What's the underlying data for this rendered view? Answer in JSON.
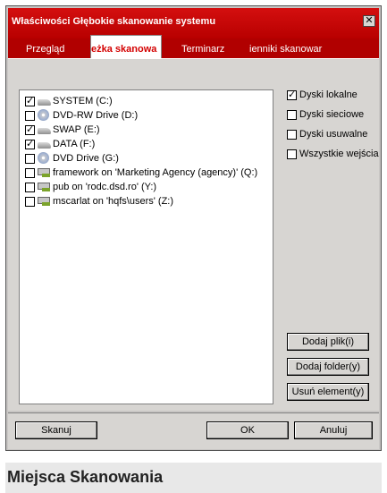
{
  "window": {
    "title": "Właściwości Głębokie skanowanie systemu"
  },
  "tabs": [
    {
      "label": "Przegląd",
      "active": false
    },
    {
      "label": "eżka skanowa",
      "active": true
    },
    {
      "label": "Terminarz",
      "active": false
    },
    {
      "label": "ienniki skanowar",
      "active": false
    }
  ],
  "drives": [
    {
      "label": "SYSTEM (C:)",
      "checked": true,
      "icon": "hdd-icon"
    },
    {
      "label": "DVD-RW Drive (D:)",
      "checked": false,
      "icon": "cd-drive-icon"
    },
    {
      "label": "SWAP (E:)",
      "checked": true,
      "icon": "hdd-icon"
    },
    {
      "label": "DATA (F:)",
      "checked": true,
      "icon": "hdd-icon"
    },
    {
      "label": "DVD Drive (G:)",
      "checked": false,
      "icon": "cd-drive-icon"
    },
    {
      "label": "framework on 'Marketing Agency (agency)' (Q:)",
      "checked": false,
      "icon": "network-drive-icon"
    },
    {
      "label": "pub on 'rodc.dsd.ro' (Y:)",
      "checked": false,
      "icon": "network-drive-icon"
    },
    {
      "label": "mscarlat on 'hqfs\\users' (Z:)",
      "checked": false,
      "icon": "network-drive-icon"
    }
  ],
  "options": [
    {
      "label": "Dyski lokalne",
      "checked": true
    },
    {
      "label": "Dyski sieciowe",
      "checked": false
    },
    {
      "label": "Dyski usuwalne",
      "checked": false
    },
    {
      "label": "Wszystkie wejścia",
      "checked": false
    }
  ],
  "buttons": {
    "add_file": "Dodaj plik(i)",
    "add_folder": "Dodaj folder(y)",
    "remove": "Usuń element(y)",
    "scan": "Skanuj",
    "ok": "OK",
    "cancel": "Anuluj"
  },
  "caption": "Miejsca Skanowania",
  "colors": {
    "accent": "#c00000",
    "dialog": "#d7d5d2"
  }
}
